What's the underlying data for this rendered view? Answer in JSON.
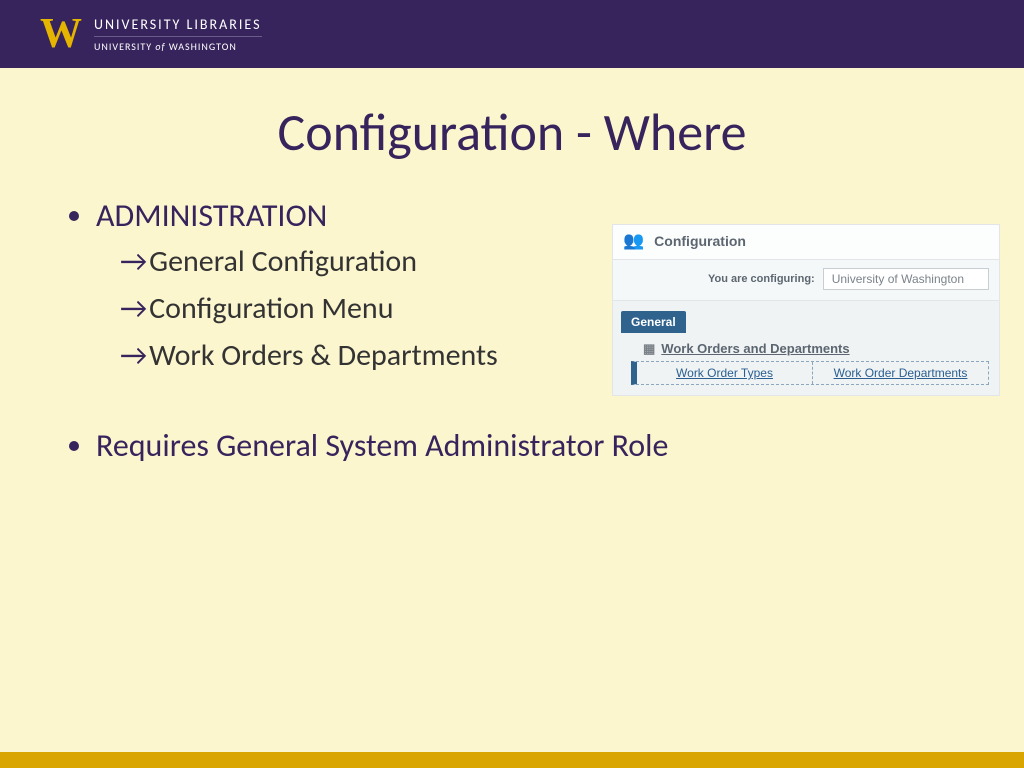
{
  "header": {
    "logo_letter": "W",
    "line1": "UNIVERSITY LIBRARIES",
    "line2_pre": "UNIVERSITY ",
    "line2_em": "of ",
    "line2_post": "WASHINGTON"
  },
  "slide": {
    "title": "Configuration - Where",
    "bullet1": "ADMINISTRATION",
    "sub": {
      "a": "General Configuration",
      "b": "Configuration Menu",
      "c": "Work Orders & Departments"
    },
    "bullet2": "Requires General System Administrator Role"
  },
  "shot": {
    "heading": "Configuration",
    "config_label": "You are configuring:",
    "config_value": "University of Washington",
    "tab": "General",
    "section": "Work Orders and Departments",
    "link1": "Work Order Types",
    "link2": "Work Order Departments"
  }
}
